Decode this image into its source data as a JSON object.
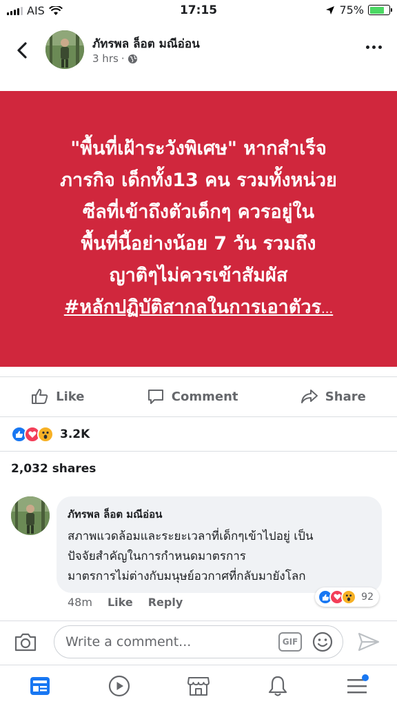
{
  "status_bar": {
    "carrier": "AIS",
    "time": "17:15",
    "battery": "75%",
    "battery_level": 0.75
  },
  "post": {
    "author": "ภัทรพล ล็อต มณีอ่อน",
    "time": "3 hrs",
    "privacy_separator": "·",
    "privacy_icon": "globe-icon",
    "card_color": "#d0273d",
    "text_lines": [
      "\"พื้นที่เฝ้าระวังพิเศษ\" หากสำเร็จ",
      "ภารกิจ เด็กทั้ง13 คน รวมทั้งหน่วย",
      "ซีลที่เข้าถึงตัวเด็กๆ ควรอยู่ใน",
      "พื้นที่นี้อย่างน้อย 7 วัน รวมถึง",
      "ญาติๆไม่ควรเข้าสัมผัส"
    ],
    "hashtag": "#หลักปฏิบัติสากลในการเอาตัวร",
    "ellipsis": "..."
  },
  "actions": {
    "like": "Like",
    "comment": "Comment",
    "share": "Share"
  },
  "reactions": {
    "count": "3.2K",
    "types": [
      "like-reaction-icon",
      "love-reaction-icon",
      "wow-reaction-icon"
    ]
  },
  "shares": "2,032 shares",
  "comment": {
    "author": "ภัทรพล ล็อต มณีอ่อน",
    "lines": [
      "สภาพแวดล้อมและระยะเวลาที่เด็กๆเข้าไปอยู่ เป็น",
      "ปัจจัยสำคัญในการกำหนดมาตรการ",
      "มาตรการไม่ต่างกับมนุษย์อวกาศที่กลับมายังโลก"
    ],
    "time": "48m",
    "like": "Like",
    "reply": "Reply",
    "reaction_count": "92"
  },
  "composer": {
    "placeholder": "Write a comment...",
    "gif": "GIF"
  },
  "tabs": [
    "news-feed-icon",
    "watch-icon",
    "marketplace-icon",
    "notifications-icon",
    "menu-icon"
  ],
  "colors": {
    "accent": "#1877f2",
    "love": "#f33e58",
    "wow": "#f7b125"
  }
}
